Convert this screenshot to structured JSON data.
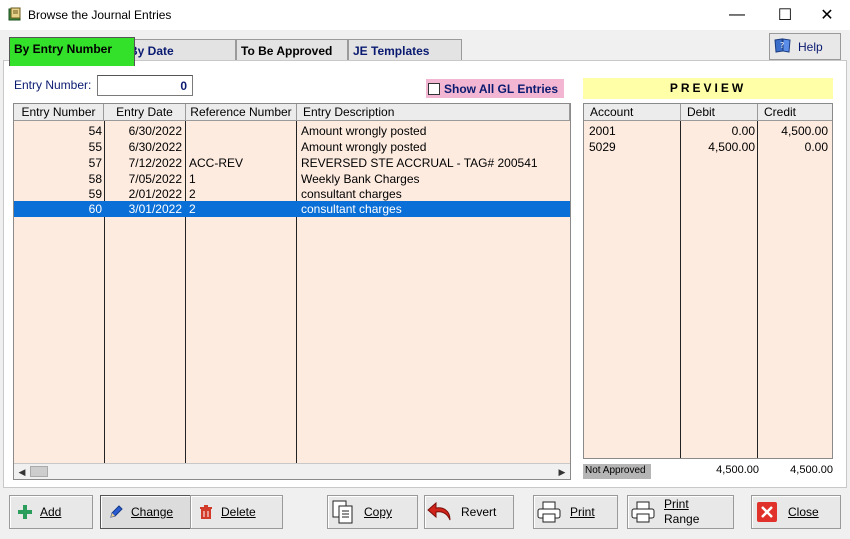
{
  "window": {
    "title": "Browse the Journal Entries",
    "min_glyph": "—",
    "max_glyph": "☐",
    "close_glyph": "✕"
  },
  "tabs": [
    {
      "label": "By Entry Number"
    },
    {
      "label": "By Date"
    },
    {
      "label": "To Be Approved"
    },
    {
      "label": "JE Templates"
    }
  ],
  "help": {
    "label": "Help"
  },
  "entry_number": {
    "label": "Entry Number:",
    "value": "0"
  },
  "show_all": {
    "label": "Show All GL Entries",
    "checked": false
  },
  "grid": {
    "columns": [
      "Entry Number",
      "Entry Date",
      "Reference Number",
      "Entry Description"
    ],
    "rows": [
      {
        "num": "54",
        "date": "6/30/2022",
        "ref": "",
        "desc": "Amount wrongly posted"
      },
      {
        "num": "55",
        "date": "6/30/2022",
        "ref": "",
        "desc": "Amount wrongly posted"
      },
      {
        "num": "57",
        "date": "7/12/2022",
        "ref": "ACC-REV",
        "desc": "REVERSED STE ACCRUAL - TAG# 200541"
      },
      {
        "num": "58",
        "date": "7/05/2022",
        "ref": "1",
        "desc": "Weekly Bank Charges"
      },
      {
        "num": "59",
        "date": "2/01/2022",
        "ref": "2",
        "desc": "consultant charges"
      },
      {
        "num": "60",
        "date": "3/01/2022",
        "ref": "2",
        "desc": "consultant charges"
      }
    ],
    "selected_index": 5
  },
  "preview": {
    "title": "PREVIEW",
    "columns": [
      "Account",
      "Debit",
      "Credit"
    ],
    "rows": [
      {
        "account": "2001",
        "debit": "0.00",
        "credit": "4,500.00"
      },
      {
        "account": "5029",
        "debit": "4,500.00",
        "credit": "0.00"
      }
    ],
    "status": "Not Approved",
    "total_debit": "4,500.00",
    "total_credit": "4,500.00"
  },
  "buttons": {
    "add": "Add",
    "change": "Change",
    "delete": "Delete",
    "copy": "Copy",
    "revert": "Revert",
    "print": "Print",
    "print_range_1": "Print",
    "print_range_2": "Range",
    "close": "Close"
  },
  "colors": {
    "active_tab": "#33e12b",
    "selection": "#0a6fd6",
    "grid_bg": "#fdebe0",
    "preview_title_bg": "#ffffa8",
    "show_all_bg": "#f2b6d2"
  }
}
